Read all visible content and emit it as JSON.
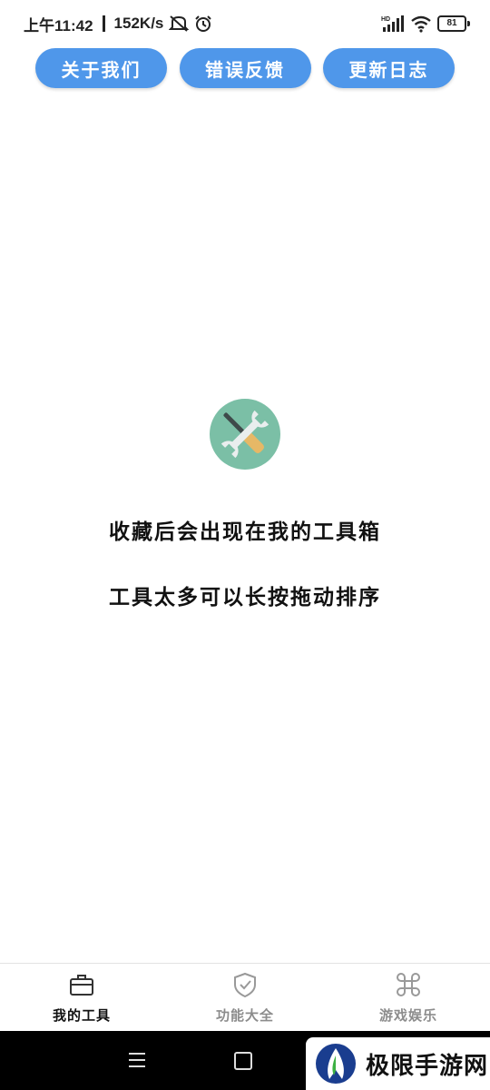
{
  "status_bar": {
    "time": "上午11:42",
    "speed": "152K/s",
    "signal_label": "HD",
    "battery": "81"
  },
  "top_buttons": [
    {
      "label": "关于我们"
    },
    {
      "label": "错误反馈"
    },
    {
      "label": "更新日志"
    }
  ],
  "empty_state": {
    "line1": "收藏后会出现在我的工具箱",
    "line2": "工具太多可以长按拖动排序"
  },
  "bottom_nav": {
    "items": [
      {
        "label": "我的工具",
        "icon": "briefcase-icon",
        "active": true
      },
      {
        "label": "功能大全",
        "icon": "shield-check-icon",
        "active": false
      },
      {
        "label": "游戏娱乐",
        "icon": "command-icon",
        "active": false
      }
    ]
  },
  "watermark": {
    "text": "极限手游网"
  },
  "colors": {
    "accent": "#4f97ea",
    "icon_circle": "#7bbfa6",
    "nav_inactive": "#8c8c8c"
  }
}
